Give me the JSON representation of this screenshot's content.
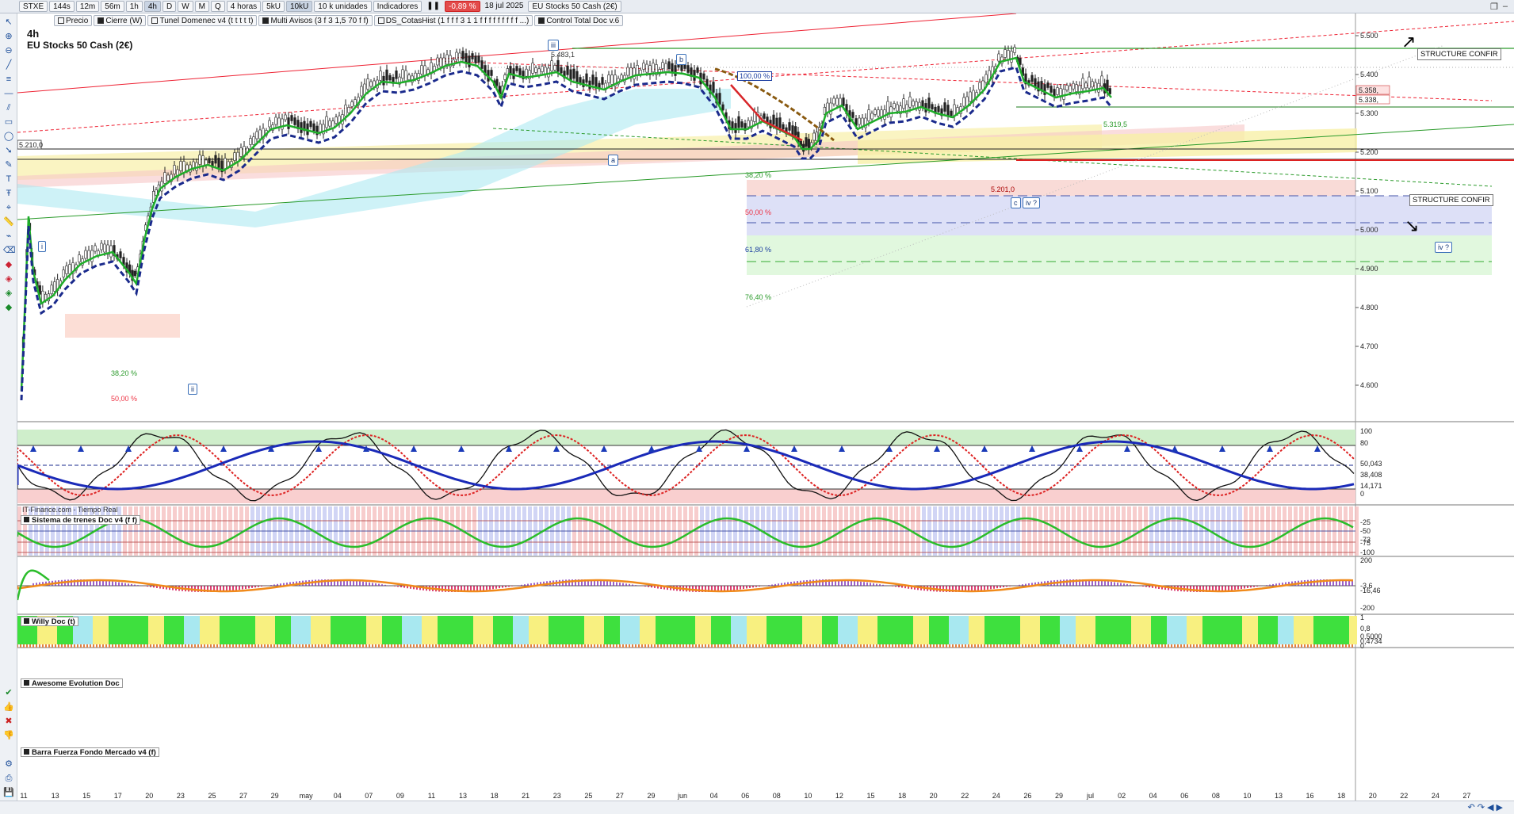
{
  "toolbar": {
    "symbol": "STXE",
    "timeframes": [
      "144s",
      "12m",
      "56m",
      "1h",
      "4h",
      "D",
      "W",
      "M",
      "Q"
    ],
    "active_timeframe": "4h",
    "period": "4 horas",
    "units_a": "5kU",
    "units_b": "10kU",
    "units_select": "10 k unidades",
    "indicators_label": "Indicadores",
    "change": "-0,89 %",
    "date": "18 jul 2025",
    "instrument": "EU Stocks 50 Cash (2€)",
    "indicator_tabs": [
      {
        "label": "Precio",
        "filled": false
      },
      {
        "label": "Cierre (W)",
        "filled": true
      },
      {
        "label": "Tunel Domenec v4 (t t t t t)",
        "filled": false
      },
      {
        "label": "Multi Avisos (3 f 3 1,5 70 f f)",
        "filled": true
      },
      {
        "label": "DS_CotasHist (1 f f f 3 1 1 f f f f f f f f f ...)",
        "filled": false
      },
      {
        "label": "Control Total Doc v.6",
        "filled": true
      }
    ]
  },
  "chart": {
    "timeframe_title": "4h",
    "instrument_title": "EU Stocks 50 Cash (2€)",
    "source": "IT-Finance.com - Tiempo Real",
    "price_box": "5.210,0",
    "price_ticks": [
      "5.500",
      "5.400",
      "5.300",
      "5.200",
      "5.100",
      "5.000",
      "4.900",
      "4.800",
      "4.700",
      "4.600"
    ],
    "right_labels": [
      "5.358,",
      "5.338,"
    ],
    "fib_labels": [
      "100,00 %",
      "38,20 %",
      "50,00 %",
      "61,80 %",
      "76,40 %",
      "38,20 %",
      "50,00 %"
    ],
    "level_labels": [
      "5.319,5",
      "5.201,0",
      "5.483,1"
    ],
    "wave_labels": [
      "i",
      "ii",
      "iii",
      "a",
      "b",
      "c",
      "iv ?",
      "iv ?"
    ],
    "structure_labels": [
      "STRUCTURE CONFIR",
      "STRUCTURE CONFIR"
    ],
    "x_ticks": [
      "11",
      "13",
      "15",
      "17",
      "20",
      "23",
      "25",
      "27",
      "29",
      "may",
      "04",
      "07",
      "09",
      "11",
      "13",
      "18",
      "21",
      "23",
      "25",
      "27",
      "29",
      "jun",
      "04",
      "06",
      "08",
      "10",
      "12",
      "15",
      "18",
      "20",
      "22",
      "24",
      "26",
      "29",
      "jul",
      "02",
      "04",
      "06",
      "08",
      "10",
      "13",
      "16",
      "18",
      "20",
      "22",
      "24",
      "27"
    ]
  },
  "panels": [
    {
      "title": "Sistema de trenes Doc v4 (f f)",
      "ticks": [
        "100",
        "80",
        "50,043",
        "38,408",
        "14,171",
        "0"
      ]
    },
    {
      "title": "Willy Doc (t)",
      "ticks": [
        "-25",
        "-50",
        "-73",
        "-75",
        "-100"
      ]
    },
    {
      "title": "Awesome Evolution Doc",
      "ticks": [
        "200",
        "-3,6",
        "-16,46",
        "-200"
      ]
    },
    {
      "title": "Barra Fuerza Fondo Mercado v4 (f)",
      "ticks": [
        "1",
        "0,8",
        "0,5000",
        "0,4734",
        "0"
      ]
    }
  ],
  "colors": {
    "up": "#1fae2a",
    "down": "#d8262a",
    "navy": "#1a2a8c",
    "brown": "#8a5a10",
    "cyan_band": "#aeeaf2",
    "yellow_band": "#f8f0a8",
    "pink_band": "#f7c6c6",
    "fib_blue": "#cfd3f4",
    "fib_green": "#d4f5d0"
  }
}
